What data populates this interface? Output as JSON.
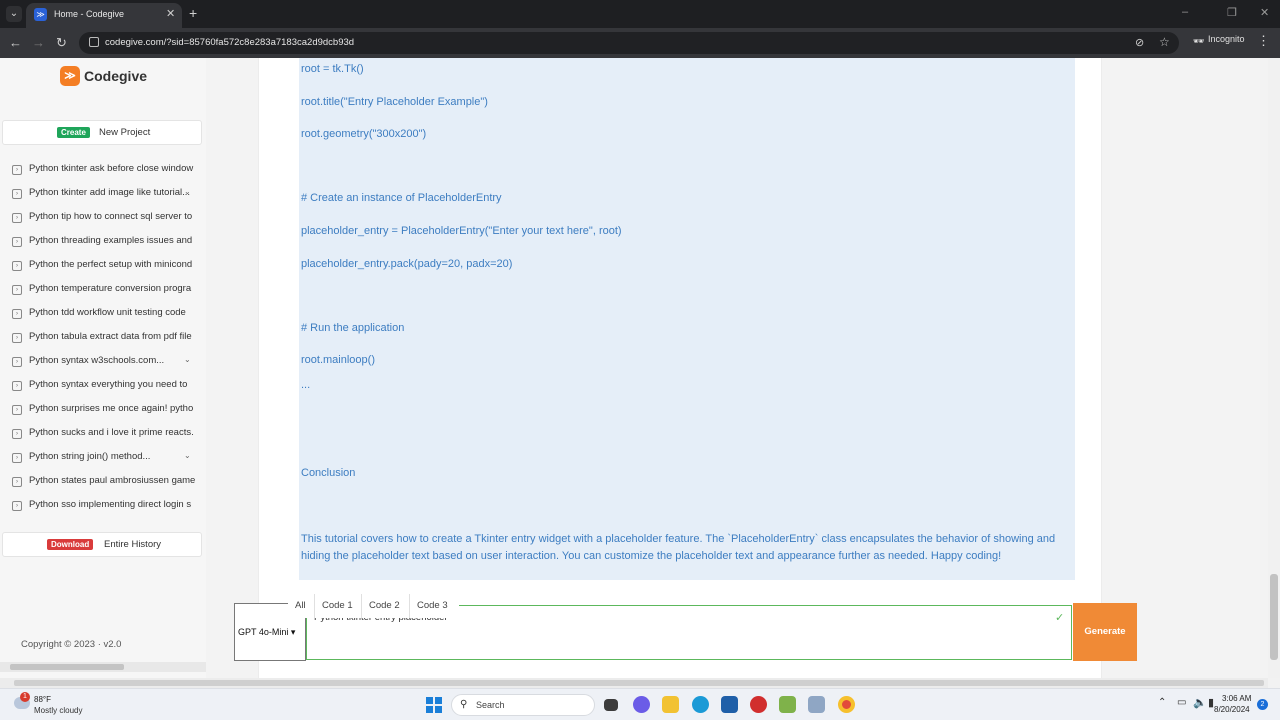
{
  "browser": {
    "tab_dropdown_icon": "chevron-down-icon",
    "tab_title": "Home - Codegive",
    "tab_favicon": "≫",
    "new_tab": "+",
    "url": "codegive.com/?sid=85760fa572c8e283a7183ca2d9dcb93d",
    "incognito_label": "Incognito",
    "window_controls": [
      "–",
      "❐",
      "✕"
    ]
  },
  "sidebar": {
    "brand": "Codegive",
    "create_badge": "Create",
    "create_label": "New Project",
    "history": [
      {
        "label": "Python tkinter ask before close window",
        "expandable": false
      },
      {
        "label": "Python tkinter add image like tutorial...",
        "expandable": true
      },
      {
        "label": "Python tip how to connect sql server to",
        "expandable": false
      },
      {
        "label": "Python threading examples issues and",
        "expandable": false
      },
      {
        "label": "Python the perfect setup with minicond",
        "expandable": false
      },
      {
        "label": "Python temperature conversion progra",
        "expandable": false
      },
      {
        "label": "Python tdd workflow unit testing code",
        "expandable": false
      },
      {
        "label": "Python tabula extract data from pdf file",
        "expandable": false
      },
      {
        "label": "Python syntax w3schools.com...",
        "expandable": true
      },
      {
        "label": "Python syntax everything you need to",
        "expandable": false
      },
      {
        "label": "Python surprises me once again! pytho",
        "expandable": false
      },
      {
        "label": "Python sucks and i love it prime reacts.",
        "expandable": false
      },
      {
        "label": "Python string join() method...",
        "expandable": true
      },
      {
        "label": "Python states paul ambrosiussen game",
        "expandable": false
      },
      {
        "label": "Python sso implementing direct login s",
        "expandable": false
      }
    ],
    "download_badge": "Download",
    "download_label": "Entire History",
    "copyright": "Copyright © 2023   ·   v2.0"
  },
  "content": {
    "code_lines": [
      "root = tk.Tk()",
      "root.title(\"Entry Placeholder Example\")",
      "root.geometry(\"300x200\")",
      "# Create an instance of PlaceholderEntry",
      "placeholder_entry = PlaceholderEntry(\"Enter your text here\", root)",
      "placeholder_entry.pack(pady=20, padx=20)",
      "# Run the application",
      "root.mainloop()",
      "...",
      "Conclusion"
    ],
    "summary": "This tutorial covers how to create a Tkinter entry widget with a placeholder feature. The `PlaceholderEntry` class encapsulates the behavior of showing and hiding the placeholder text based on user interaction. You can customize the placeholder text and appearance further as needed. Happy coding!"
  },
  "prompt_bar": {
    "model": "GPT 4o-Mini",
    "tabs": [
      "All",
      "Code 1",
      "Code 2",
      "Code 3"
    ],
    "prompt_value": "Python tkinter entry placeholder",
    "generate_label": "Generate"
  },
  "taskbar": {
    "weather_badge": "1",
    "temperature": "88°F",
    "weather_desc": "Mostly cloudy",
    "search_label": "Search",
    "time": "3:06 AM",
    "date": "8/20/2024",
    "notification_count": "2"
  },
  "colors": {
    "accent": "#f08a36",
    "code_text": "#3d7dc1",
    "code_bg": "#e5eef8",
    "create_badge": "#1fa55a",
    "download_badge": "#d93b3b"
  }
}
